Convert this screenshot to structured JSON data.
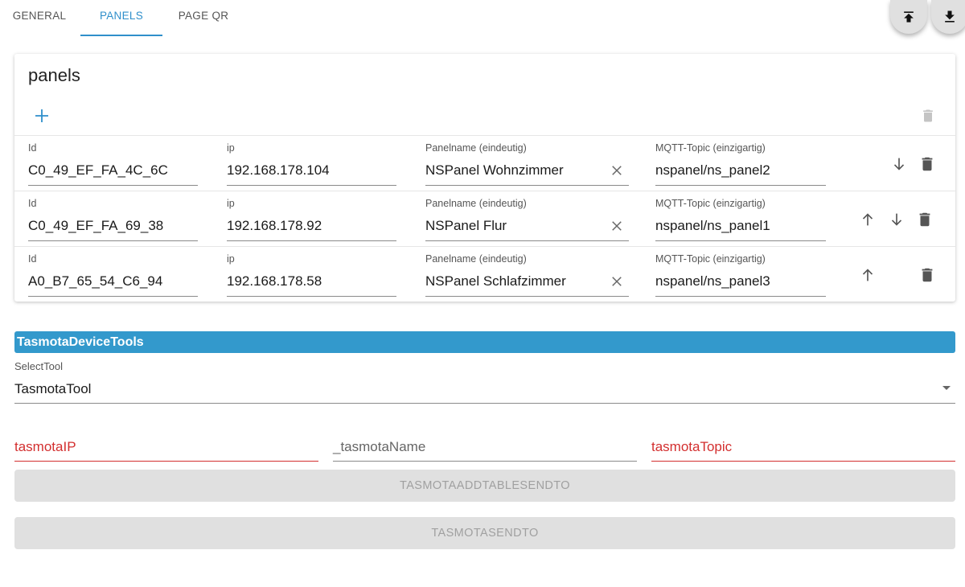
{
  "tabs": [
    {
      "label": "GENERAL"
    },
    {
      "label": "PANELS"
    },
    {
      "label": "PAGE QR"
    }
  ],
  "active_tab": "PANELS",
  "fabs": {
    "upload_icon": "upload-icon",
    "download_icon": "download-icon"
  },
  "panels_card": {
    "title": "panels",
    "columns": {
      "id": "Id",
      "ip": "ip",
      "name": "Panelname (eindeutig)",
      "topic": "MQTT-Topic (einzigartig)"
    },
    "rows": [
      {
        "id": "C0_49_EF_FA_4C_6C",
        "ip": "192.168.178.104",
        "name": "NSPanel Wohnzimmer",
        "topic": "nspanel/ns_panel2"
      },
      {
        "id": "C0_49_EF_FA_69_38",
        "ip": "192.168.178.92",
        "name": "NSPanel Flur",
        "topic": "nspanel/ns_panel1"
      },
      {
        "id": "A0_B7_65_54_C6_94",
        "ip": "192.168.178.58",
        "name": "NSPanel Schlafzimmer",
        "topic": "nspanel/ns_panel3"
      }
    ]
  },
  "tools": {
    "header": "TasmotaDeviceTools",
    "select_label": "SelectTool",
    "select_value": "TasmotaTool",
    "fields": {
      "ip": "tasmotaIP",
      "name": "_tasmotaName",
      "topic": "tasmotaTopic"
    },
    "buttons": {
      "addtable": "TASMOTAADDTABLESENDTO",
      "send": "TASMOTASENDTO"
    }
  },
  "colors": {
    "accent": "#2f8fcb",
    "header_bg": "#3399cc",
    "error": "#d32f2f"
  }
}
